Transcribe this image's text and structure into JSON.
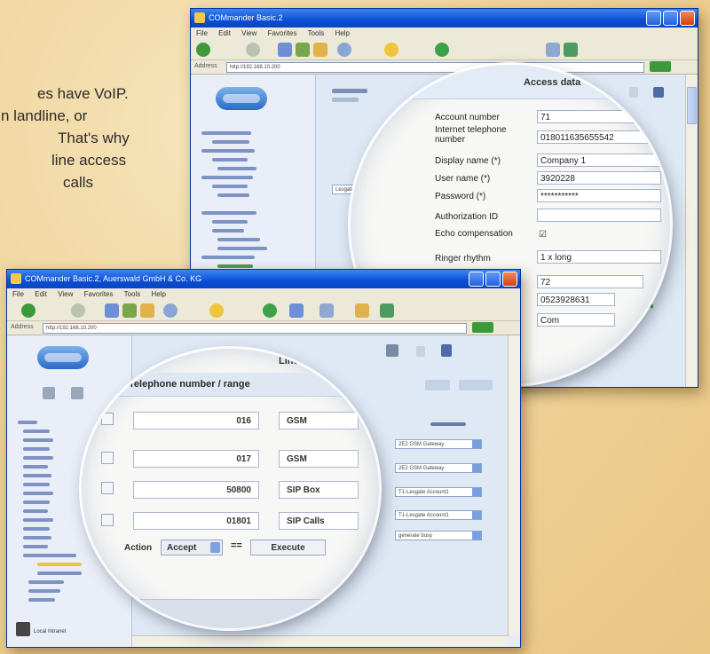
{
  "intro_text": {
    "line1": "es have VoIP.",
    "line2": "n landline, or",
    "line3": "That's why",
    "line4": "line access",
    "line5": "calls"
  },
  "window_back": {
    "title": "COMmander Basic.2",
    "menu": [
      "File",
      "Edit",
      "View",
      "Favorites",
      "Tools",
      "Help"
    ],
    "address_label": "Address",
    "address": "http://192.168.10.200",
    "side_select": "Lesgate",
    "row_status": "●●●",
    "lens": {
      "section_title": "Access data",
      "fields": [
        {
          "label": "Account number",
          "value": "71"
        },
        {
          "label": "Internet telephone number",
          "value": "018011635655542"
        },
        {
          "label": "Display name (*)",
          "value": "Company 1"
        },
        {
          "label": "User name (*)",
          "value": "3920228"
        },
        {
          "label": "Password (*)",
          "value": "***********"
        },
        {
          "label": "Authorization ID",
          "value": ""
        },
        {
          "label": "Echo compensation",
          "value": "☑"
        },
        {
          "label": "Ringer rhythm",
          "value": "1 x long"
        }
      ],
      "extra_values": [
        "72",
        "0523928631",
        "Com"
      ]
    }
  },
  "window_front": {
    "title": "COMmander Basic.2, Auerswald GmbH & Co. KG",
    "menu": [
      "File",
      "Edit",
      "View",
      "Favorites",
      "Tools",
      "Help"
    ],
    "address_label": "Address",
    "address": "http://192.168.10.200",
    "status_label": "Local Intranet",
    "right_selects": [
      "2E2 GSM Gateway",
      "2E2 GSM Gateway",
      "T1-Lesgate Account1",
      "T1-Lesgate Account1",
      "generate busy"
    ],
    "lens": {
      "lines_per_page": "Lines per pag",
      "col_number": "Telephone number / range",
      "rows": [
        {
          "number": "016",
          "type": "GSM"
        },
        {
          "number": "017",
          "type": "GSM"
        },
        {
          "number": "50800",
          "type": "SIP Box"
        },
        {
          "number": "01801",
          "type": "SIP Calls"
        }
      ],
      "action_label": "Action",
      "action_value": "Accept",
      "arrows": "==",
      "execute": "Execute"
    }
  }
}
